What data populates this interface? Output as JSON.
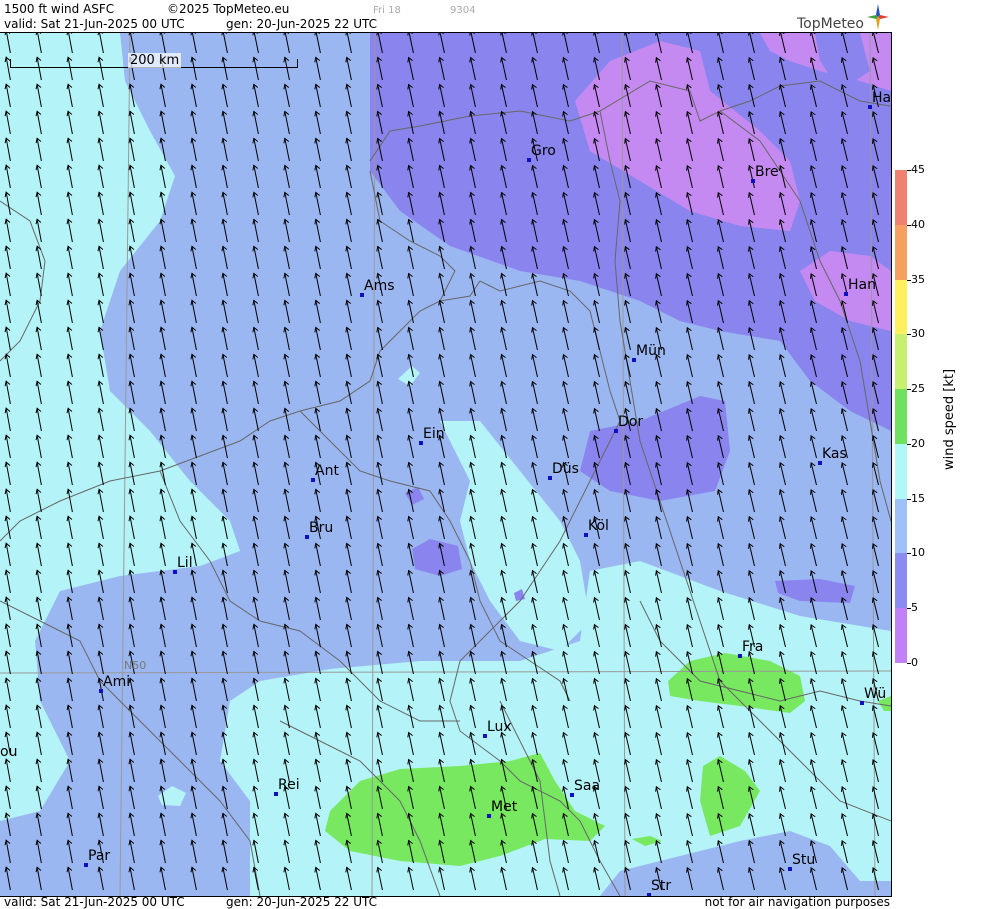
{
  "header": {
    "product": "1500 ft wind ASFC",
    "copyright": "©2025 TopMeteo.eu",
    "valid": "valid:  Sat  21-Jun-2025  00 UTC",
    "gen": "gen: 20-Jun-2025 22 UTC",
    "faint_1": "Fri 18",
    "faint_2": "9304"
  },
  "logo": {
    "text": "TopMeteo",
    "icon": "compass-star-icon"
  },
  "footer": {
    "valid": "valid:  Sat  21-Jun-2025  00 UTC",
    "gen": "gen: 20-Jun-2025 22 UTC",
    "disclaimer": "not for air navigation purposes"
  },
  "scale_bar": {
    "label": "200 km"
  },
  "lat_label": "N50",
  "cities": [
    {
      "name": "Ha",
      "key": "ham"
    },
    {
      "name": "Gro",
      "key": "gro"
    },
    {
      "name": "Bre",
      "key": "bre"
    },
    {
      "name": "Ams",
      "key": "ams"
    },
    {
      "name": "Han",
      "key": "han"
    },
    {
      "name": "Mün",
      "key": "mun"
    },
    {
      "name": "Dor",
      "key": "dor"
    },
    {
      "name": "Ein",
      "key": "ein"
    },
    {
      "name": "Kas",
      "key": "kas"
    },
    {
      "name": "Ant",
      "key": "ant"
    },
    {
      "name": "Düs",
      "key": "dus"
    },
    {
      "name": "Köl",
      "key": "kol"
    },
    {
      "name": "Bru",
      "key": "bru"
    },
    {
      "name": "Lil",
      "key": "lil"
    },
    {
      "name": "Fra",
      "key": "fra"
    },
    {
      "name": "Ami",
      "key": "ami"
    },
    {
      "name": "Wü",
      "key": "wue"
    },
    {
      "name": "Lux",
      "key": "lux"
    },
    {
      "name": "ou",
      "key": "rou"
    },
    {
      "name": "Rei",
      "key": "rei"
    },
    {
      "name": "Saa",
      "key": "saa"
    },
    {
      "name": "Met",
      "key": "met"
    },
    {
      "name": "Par",
      "key": "par"
    },
    {
      "name": "Stu",
      "key": "stu"
    },
    {
      "name": "Str",
      "key": "str"
    }
  ],
  "colorbar": {
    "title": "wind speed [kt]",
    "ticks": [
      "45",
      "40",
      "35",
      "30",
      "25",
      "20",
      "15",
      "10",
      "5",
      "0"
    ],
    "colors": [
      "#f08070",
      "#f5a060",
      "#fff060",
      "#c8f070",
      "#70e060",
      "#b0f8f8",
      "#a0c0f8",
      "#8c8cf0",
      "#c080f8"
    ]
  },
  "field": {
    "wind_direction": "south-east (arrows pointing north-west)",
    "colors": {
      "cyan_0_15": "#b4f4f8",
      "blue_10_15": "#9bb7f2",
      "violet_5_10": "#8a85ee",
      "purple_0_5": "#c58af2",
      "green_20_25": "#78e860"
    }
  }
}
